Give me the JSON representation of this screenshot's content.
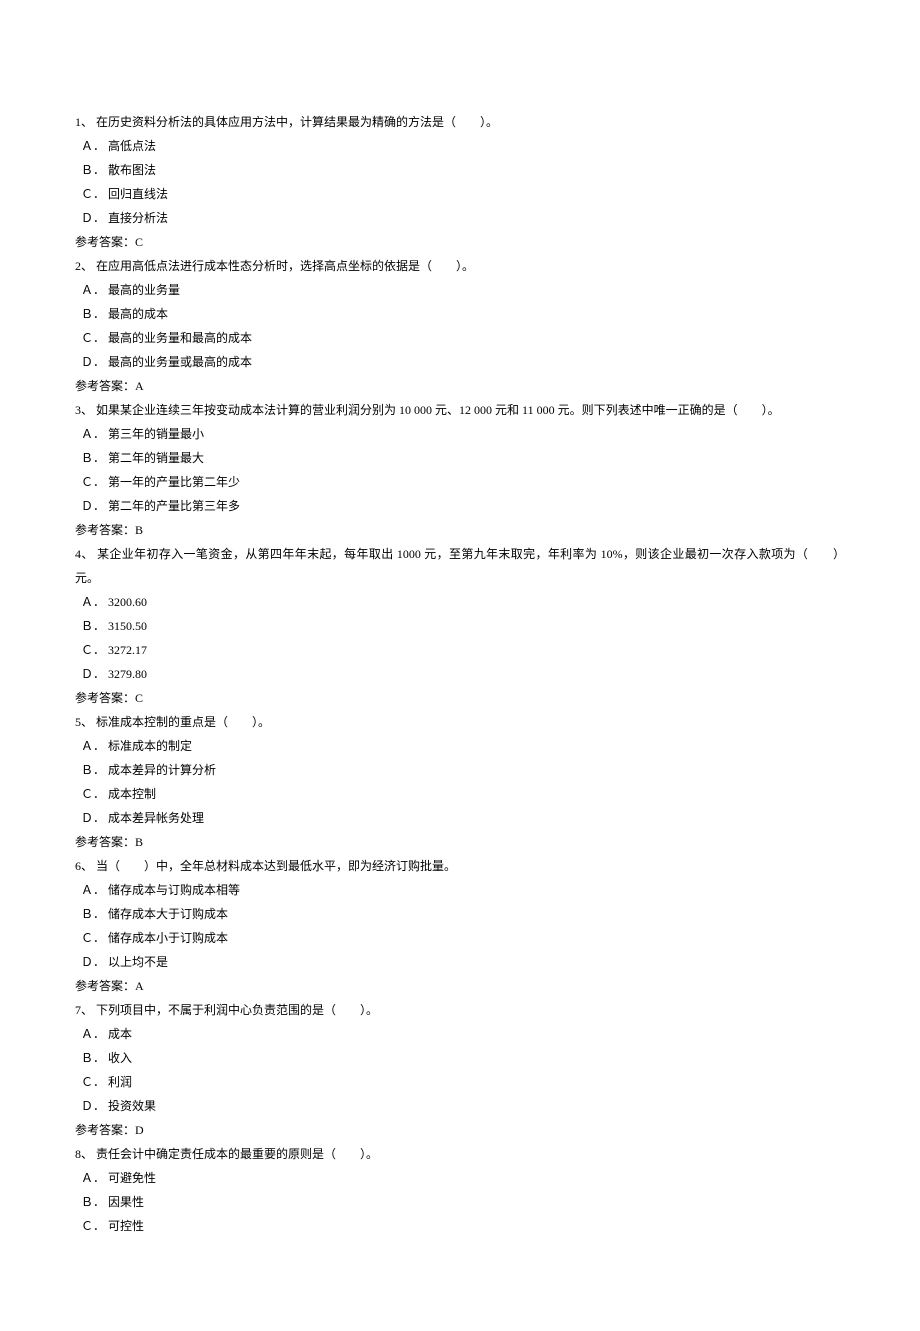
{
  "questions": [
    {
      "num": "1、",
      "stem": "在历史资料分析法的具体应用方法中，计算结果最为精确的方法是（　　）。",
      "opts": [
        "Ａ． 高低点法",
        "Ｂ． 散布图法",
        "Ｃ． 回归直线法",
        "Ｄ． 直接分析法"
      ],
      "ans": "参考答案：C"
    },
    {
      "num": "2、",
      "stem": "在应用高低点法进行成本性态分析时，选择高点坐标的依据是（　　）。",
      "opts": [
        "Ａ． 最高的业务量",
        "Ｂ． 最高的成本",
        "Ｃ． 最高的业务量和最高的成本",
        "Ｄ． 最高的业务量或最高的成本"
      ],
      "ans": "参考答案：A"
    },
    {
      "num": "3、",
      "stem": "如果某企业连续三年按变动成本法计算的营业利润分别为 10 000 元、12 000 元和 11 000 元。则下列表述中唯一正确的是（　　）。",
      "opts": [
        "Ａ． 第三年的销量最小",
        "Ｂ． 第二年的销量最大",
        "Ｃ． 第一年的产量比第二年少",
        "Ｄ． 第二年的产量比第三年多"
      ],
      "ans": "参考答案：B"
    },
    {
      "num": "4、",
      "stem": "某企业年初存入一笔资金，从第四年年末起，每年取出 1000 元，至第九年末取完，年利率为 10%，则该企业最初一次存入款项为（　　）元。",
      "opts": [
        "Ａ． 3200.60",
        "Ｂ． 3150.50",
        "Ｃ． 3272.17",
        "Ｄ． 3279.80"
      ],
      "ans": "参考答案：C"
    },
    {
      "num": "5、",
      "stem": "标准成本控制的重点是（　　）。",
      "opts": [
        "Ａ． 标准成本的制定",
        "Ｂ． 成本差异的计算分析",
        "Ｃ． 成本控制",
        "Ｄ． 成本差异帐务处理"
      ],
      "ans": "参考答案：B"
    },
    {
      "num": "6、",
      "stem": "当（　　）中，全年总材料成本达到最低水平，即为经济订购批量。",
      "opts": [
        "Ａ． 储存成本与订购成本相等",
        "Ｂ． 储存成本大于订购成本",
        "Ｃ． 储存成本小于订购成本",
        "Ｄ． 以上均不是"
      ],
      "ans": "参考答案：A"
    },
    {
      "num": "7、",
      "stem": "下列项目中，不属于利润中心负责范围的是（　　）。",
      "opts": [
        "Ａ． 成本",
        "Ｂ． 收入",
        "Ｃ． 利润",
        "Ｄ． 投资效果"
      ],
      "ans": "参考答案：D"
    },
    {
      "num": "8、",
      "stem": "责任会计中确定责任成本的最重要的原则是（　　）。",
      "opts": [
        "Ａ． 可避免性",
        "Ｂ． 因果性",
        "Ｃ． 可控性"
      ],
      "ans": null
    }
  ]
}
